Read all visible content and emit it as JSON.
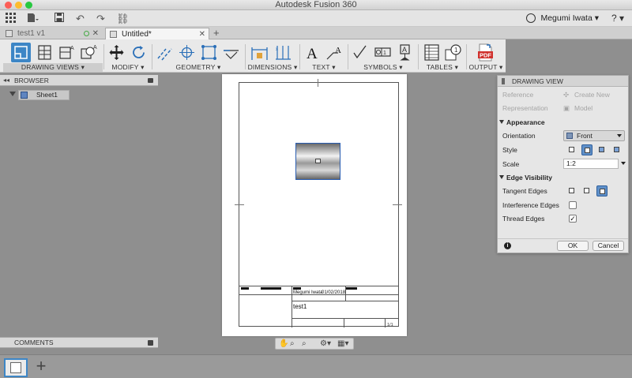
{
  "window": {
    "title": "Autodesk Fusion 360"
  },
  "appbar": {
    "user_name": "Megumi Iwata ▾",
    "help": "? ▾"
  },
  "tabs": [
    {
      "label": "test1 v1",
      "active": false
    },
    {
      "label": "Untitled*",
      "active": true
    }
  ],
  "toolbar": {
    "groups": [
      {
        "label": "DRAWING VIEWS ▾"
      },
      {
        "label": "MODIFY ▾"
      },
      {
        "label": "GEOMETRY ▾"
      },
      {
        "label": "DIMENSIONS ▾"
      },
      {
        "label": "TEXT ▾"
      },
      {
        "label": "SYMBOLS ▾"
      },
      {
        "label": "TABLES ▾"
      },
      {
        "label": "OUTPUT ▾"
      }
    ],
    "output_pdf_label": "PDF"
  },
  "browser": {
    "title": "BROWSER",
    "sheet_label": "Sheet1"
  },
  "comments": {
    "title": "COMMENTS"
  },
  "sheet": {
    "titleblock": {
      "author": "Megumi Iwata",
      "date": "01/02/2018",
      "part_name": "test1",
      "sheet_number": "1/1"
    }
  },
  "dialog": {
    "title": "DRAWING VIEW",
    "reference_label": "Reference",
    "reference_value": "Create New",
    "representation_label": "Representation",
    "representation_value": "Model",
    "appearance_section": "Appearance",
    "orientation_label": "Orientation",
    "orientation_value": "Front",
    "style_label": "Style",
    "scale_label": "Scale",
    "scale_value": "1:2",
    "edge_section": "Edge Visibility",
    "tangent_label": "Tangent Edges",
    "interference_label": "Interference Edges",
    "interference_checked": false,
    "thread_label": "Thread Edges",
    "thread_checked": true,
    "ok_label": "OK",
    "cancel_label": "Cancel"
  },
  "colors": {
    "accent": "#3d86c6",
    "pdf_red": "#d0312d"
  }
}
